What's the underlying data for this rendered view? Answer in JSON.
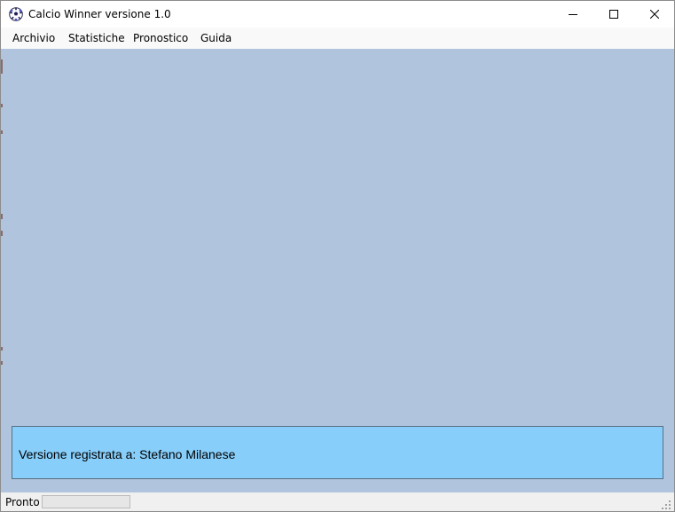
{
  "window": {
    "title": "Calcio Winner versione 1.0",
    "app_icon": "soccer-ball-icon",
    "controls": [
      "minimize-icon",
      "maximize-icon",
      "close-icon"
    ]
  },
  "menu": {
    "items": [
      {
        "label": "Archivio"
      },
      {
        "label": "Statistiche"
      },
      {
        "label": "Pronostico"
      },
      {
        "label": "Guida"
      }
    ]
  },
  "main": {
    "background_color": "#b0c4de",
    "registration": {
      "text": "Versione registrata a: Stefano Milanese",
      "background_color": "#87cefa"
    }
  },
  "statusbar": {
    "text": "Pronto",
    "progress": 0
  }
}
